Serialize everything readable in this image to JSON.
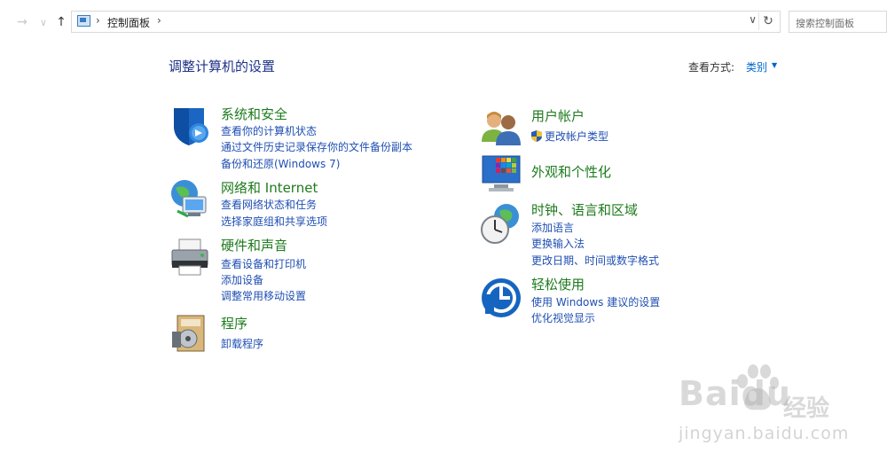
{
  "address_bar": {
    "breadcrumb": "控制面板",
    "search_placeholder": "搜索控制面板",
    "back_icon": "back-arrow-icon",
    "forward_icon": "forward-arrow-icon",
    "up_icon": "up-arrow-icon",
    "refresh_icon": "refresh-icon"
  },
  "header": {
    "title": "调整计算机的设置",
    "view_label": "查看方式:",
    "view_value": "类别"
  },
  "categories": {
    "system": {
      "title": "系统和安全",
      "links": [
        "查看你的计算机状态",
        "通过文件历史记录保存你的文件备份副本",
        "备份和还原(Windows 7)"
      ]
    },
    "network": {
      "title": "网络和 Internet",
      "links": [
        "查看网络状态和任务",
        "选择家庭组和共享选项"
      ]
    },
    "hardware": {
      "title": "硬件和声音",
      "links": [
        "查看设备和打印机",
        "添加设备",
        "调整常用移动设置"
      ]
    },
    "programs": {
      "title": "程序",
      "links": [
        "卸载程序"
      ]
    },
    "user": {
      "title": "用户帐户",
      "links": [
        "更改帐户类型"
      ]
    },
    "appearance": {
      "title": "外观和个性化",
      "links": []
    },
    "clock": {
      "title": "时钟、语言和区域",
      "links": [
        "添加语言",
        "更换输入法",
        "更改日期、时间或数字格式"
      ]
    },
    "ease": {
      "title": "轻松使用",
      "links": [
        "使用 Windows 建议的设置",
        "优化视觉显示"
      ]
    }
  },
  "watermark": {
    "brand": "Baidu",
    "brand_cn": "经验",
    "url": "jingyan.baidu.com"
  },
  "colors": {
    "category_title": "#1e7b1e",
    "link": "#1f4fb3",
    "page_title": "#1e3287"
  }
}
